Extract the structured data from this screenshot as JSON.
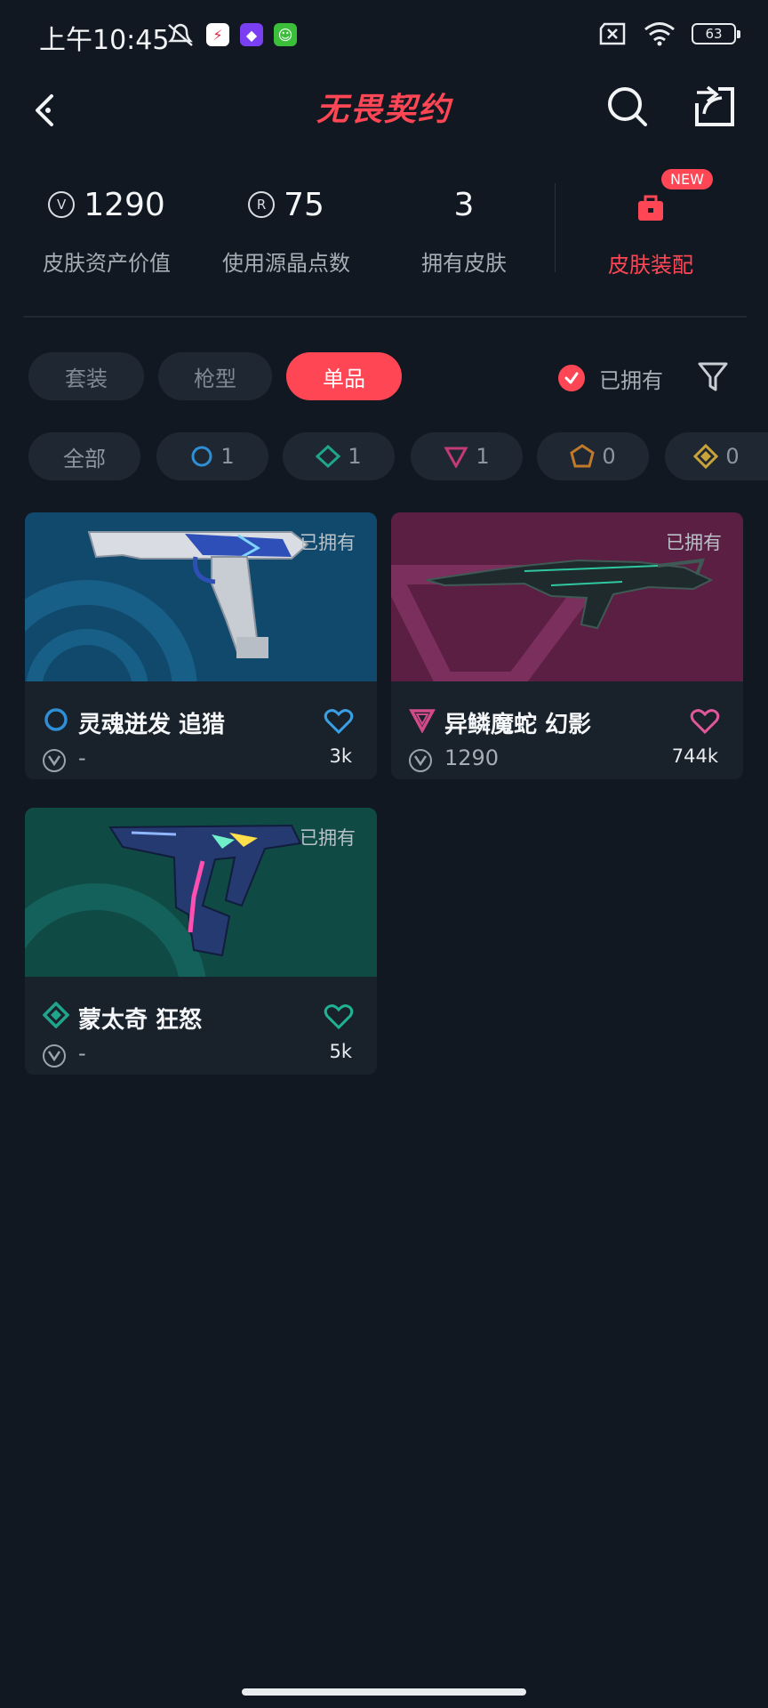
{
  "status_bar": {
    "time": "上午10:45",
    "battery": "63"
  },
  "header": {
    "title": "无畏契约"
  },
  "stats": {
    "asset_value": "1290",
    "asset_value_label": "皮肤资产价值",
    "radianite_used": "75",
    "radianite_used_label": "使用源晶点数",
    "skins_owned": "3",
    "skins_owned_label": "拥有皮肤",
    "loadout_label": "皮肤装配",
    "new_badge": "NEW"
  },
  "tabs": [
    {
      "label": "套装",
      "active": false
    },
    {
      "label": "枪型",
      "active": false
    },
    {
      "label": "单品",
      "active": true
    }
  ],
  "owned_filter_label": "已拥有",
  "rarity_chips": [
    {
      "label": "全部",
      "count": ""
    },
    {
      "icon": "select-tier-icon",
      "count": "1",
      "color": "#2f8fd6"
    },
    {
      "icon": "deluxe-tier-icon",
      "count": "1",
      "color": "#1fa58c"
    },
    {
      "icon": "premium-tier-icon",
      "count": "1",
      "color": "#c23a78"
    },
    {
      "icon": "exclusive-tier-icon",
      "count": "0",
      "color": "#c07a2a"
    },
    {
      "icon": "ultra-tier-icon",
      "count": "0",
      "color": "#c9a23a"
    }
  ],
  "cards": [
    {
      "name": "灵魂迸发 追猎",
      "owned": "已拥有",
      "price": "-",
      "likes": "3k",
      "tier_color": "#2f8fd6",
      "heart_color": "#3aa0e6",
      "bg": "#10496b"
    },
    {
      "name": "异鳞魔蛇 幻影",
      "owned": "已拥有",
      "price": "1290",
      "likes": "744k",
      "tier_color": "#d24a8a",
      "heart_color": "#e0579a",
      "bg": "#5a1f42"
    },
    {
      "name": "蒙太奇 狂怒",
      "owned": "已拥有",
      "price": "-",
      "likes": "5k",
      "tier_color": "#1fa58c",
      "heart_color": "#1fb394",
      "bg": "#0f4a44"
    }
  ]
}
